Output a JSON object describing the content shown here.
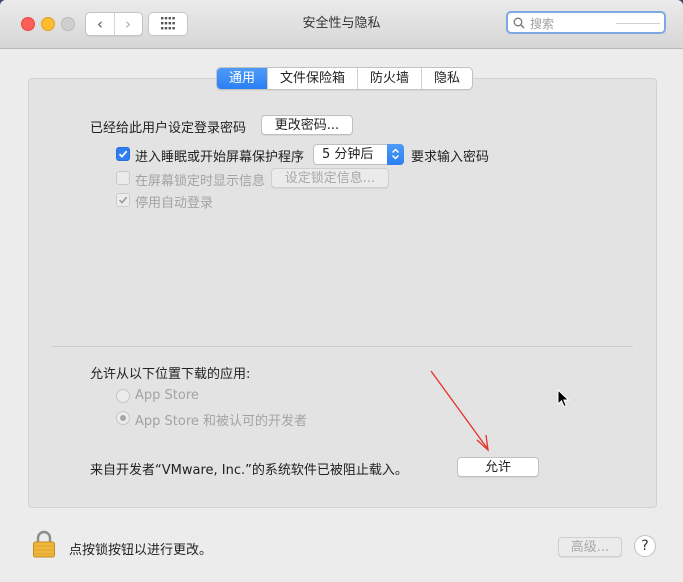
{
  "window": {
    "title": "安全性与隐私"
  },
  "toolbar": {
    "search_placeholder": "搜索"
  },
  "tabs": [
    {
      "label": "通用",
      "active": true
    },
    {
      "label": "文件保险箱",
      "active": false
    },
    {
      "label": "防火墙",
      "active": false
    },
    {
      "label": "隐私",
      "active": false
    }
  ],
  "general": {
    "password_set_label": "已经给此用户设定登录密码",
    "change_password_button": "更改密码...",
    "require_password": {
      "prefix": "进入睡眠或开始屏幕保护程序",
      "delay_value": "5 分钟后",
      "suffix": "要求输入密码",
      "checked": true
    },
    "show_message": {
      "label": "在屏幕锁定时显示信息",
      "checked": false,
      "disabled": true
    },
    "set_lock_message_button": "设定锁定信息...",
    "disable_auto_login": {
      "label": "停用自动登录",
      "checked": true,
      "disabled": true
    }
  },
  "downloads": {
    "heading": "允许从以下位置下载的应用:",
    "options": [
      {
        "label": "App Store",
        "selected": false
      },
      {
        "label": "App Store 和被认可的开发者",
        "selected": true
      }
    ],
    "blocked_message": "来自开发者“VMware, Inc.”的系统软件已被阻止载入。",
    "allow_button": "允许"
  },
  "footer": {
    "lock_message": "点按锁按钮以进行更改。",
    "advanced_button": "高级...",
    "help_button": "?"
  },
  "colors": {
    "accent": "#2a7ff3",
    "annotation_arrow": "#e8302a"
  }
}
